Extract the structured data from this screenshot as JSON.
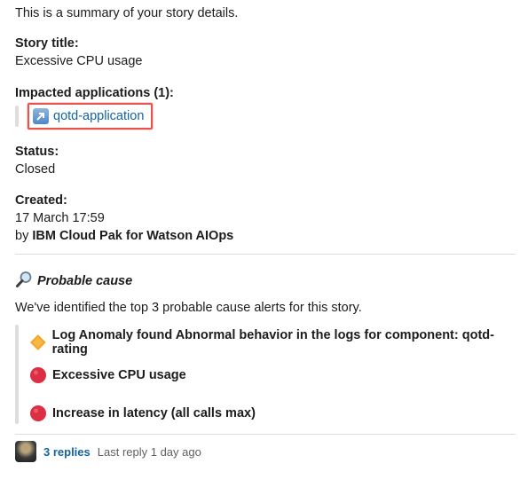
{
  "intro": "This is a summary of your story details.",
  "story_title": {
    "label": "Story title:",
    "value": "Excessive CPU usage"
  },
  "impacted": {
    "label": "Impacted applications (1):",
    "app_link": "qotd-application"
  },
  "status": {
    "label": "Status:",
    "value": "Closed"
  },
  "created": {
    "label": "Created:",
    "date": "17 March 17:59",
    "by_prefix": "by ",
    "by_name": "IBM Cloud Pak for Watson AIOps"
  },
  "probable_cause": {
    "title": "Probable cause",
    "description": "We've identified the top 3 probable cause alerts for this story.",
    "alerts": [
      {
        "icon": "orange-diamond-icon",
        "text": "Log Anomaly found Abnormal behavior in the logs for component: qotd-rating"
      },
      {
        "icon": "red-circle-icon",
        "text": "Excessive CPU usage"
      },
      {
        "icon": "red-circle-icon",
        "text": "Increase in latency (all calls max)"
      }
    ]
  },
  "thread": {
    "replies": "3 replies",
    "last_reply": "Last reply 1 day ago"
  },
  "colors": {
    "link": "#1264a3",
    "highlight": "#e8534c",
    "orange": "#f5a623",
    "red": "#dd2e44"
  }
}
